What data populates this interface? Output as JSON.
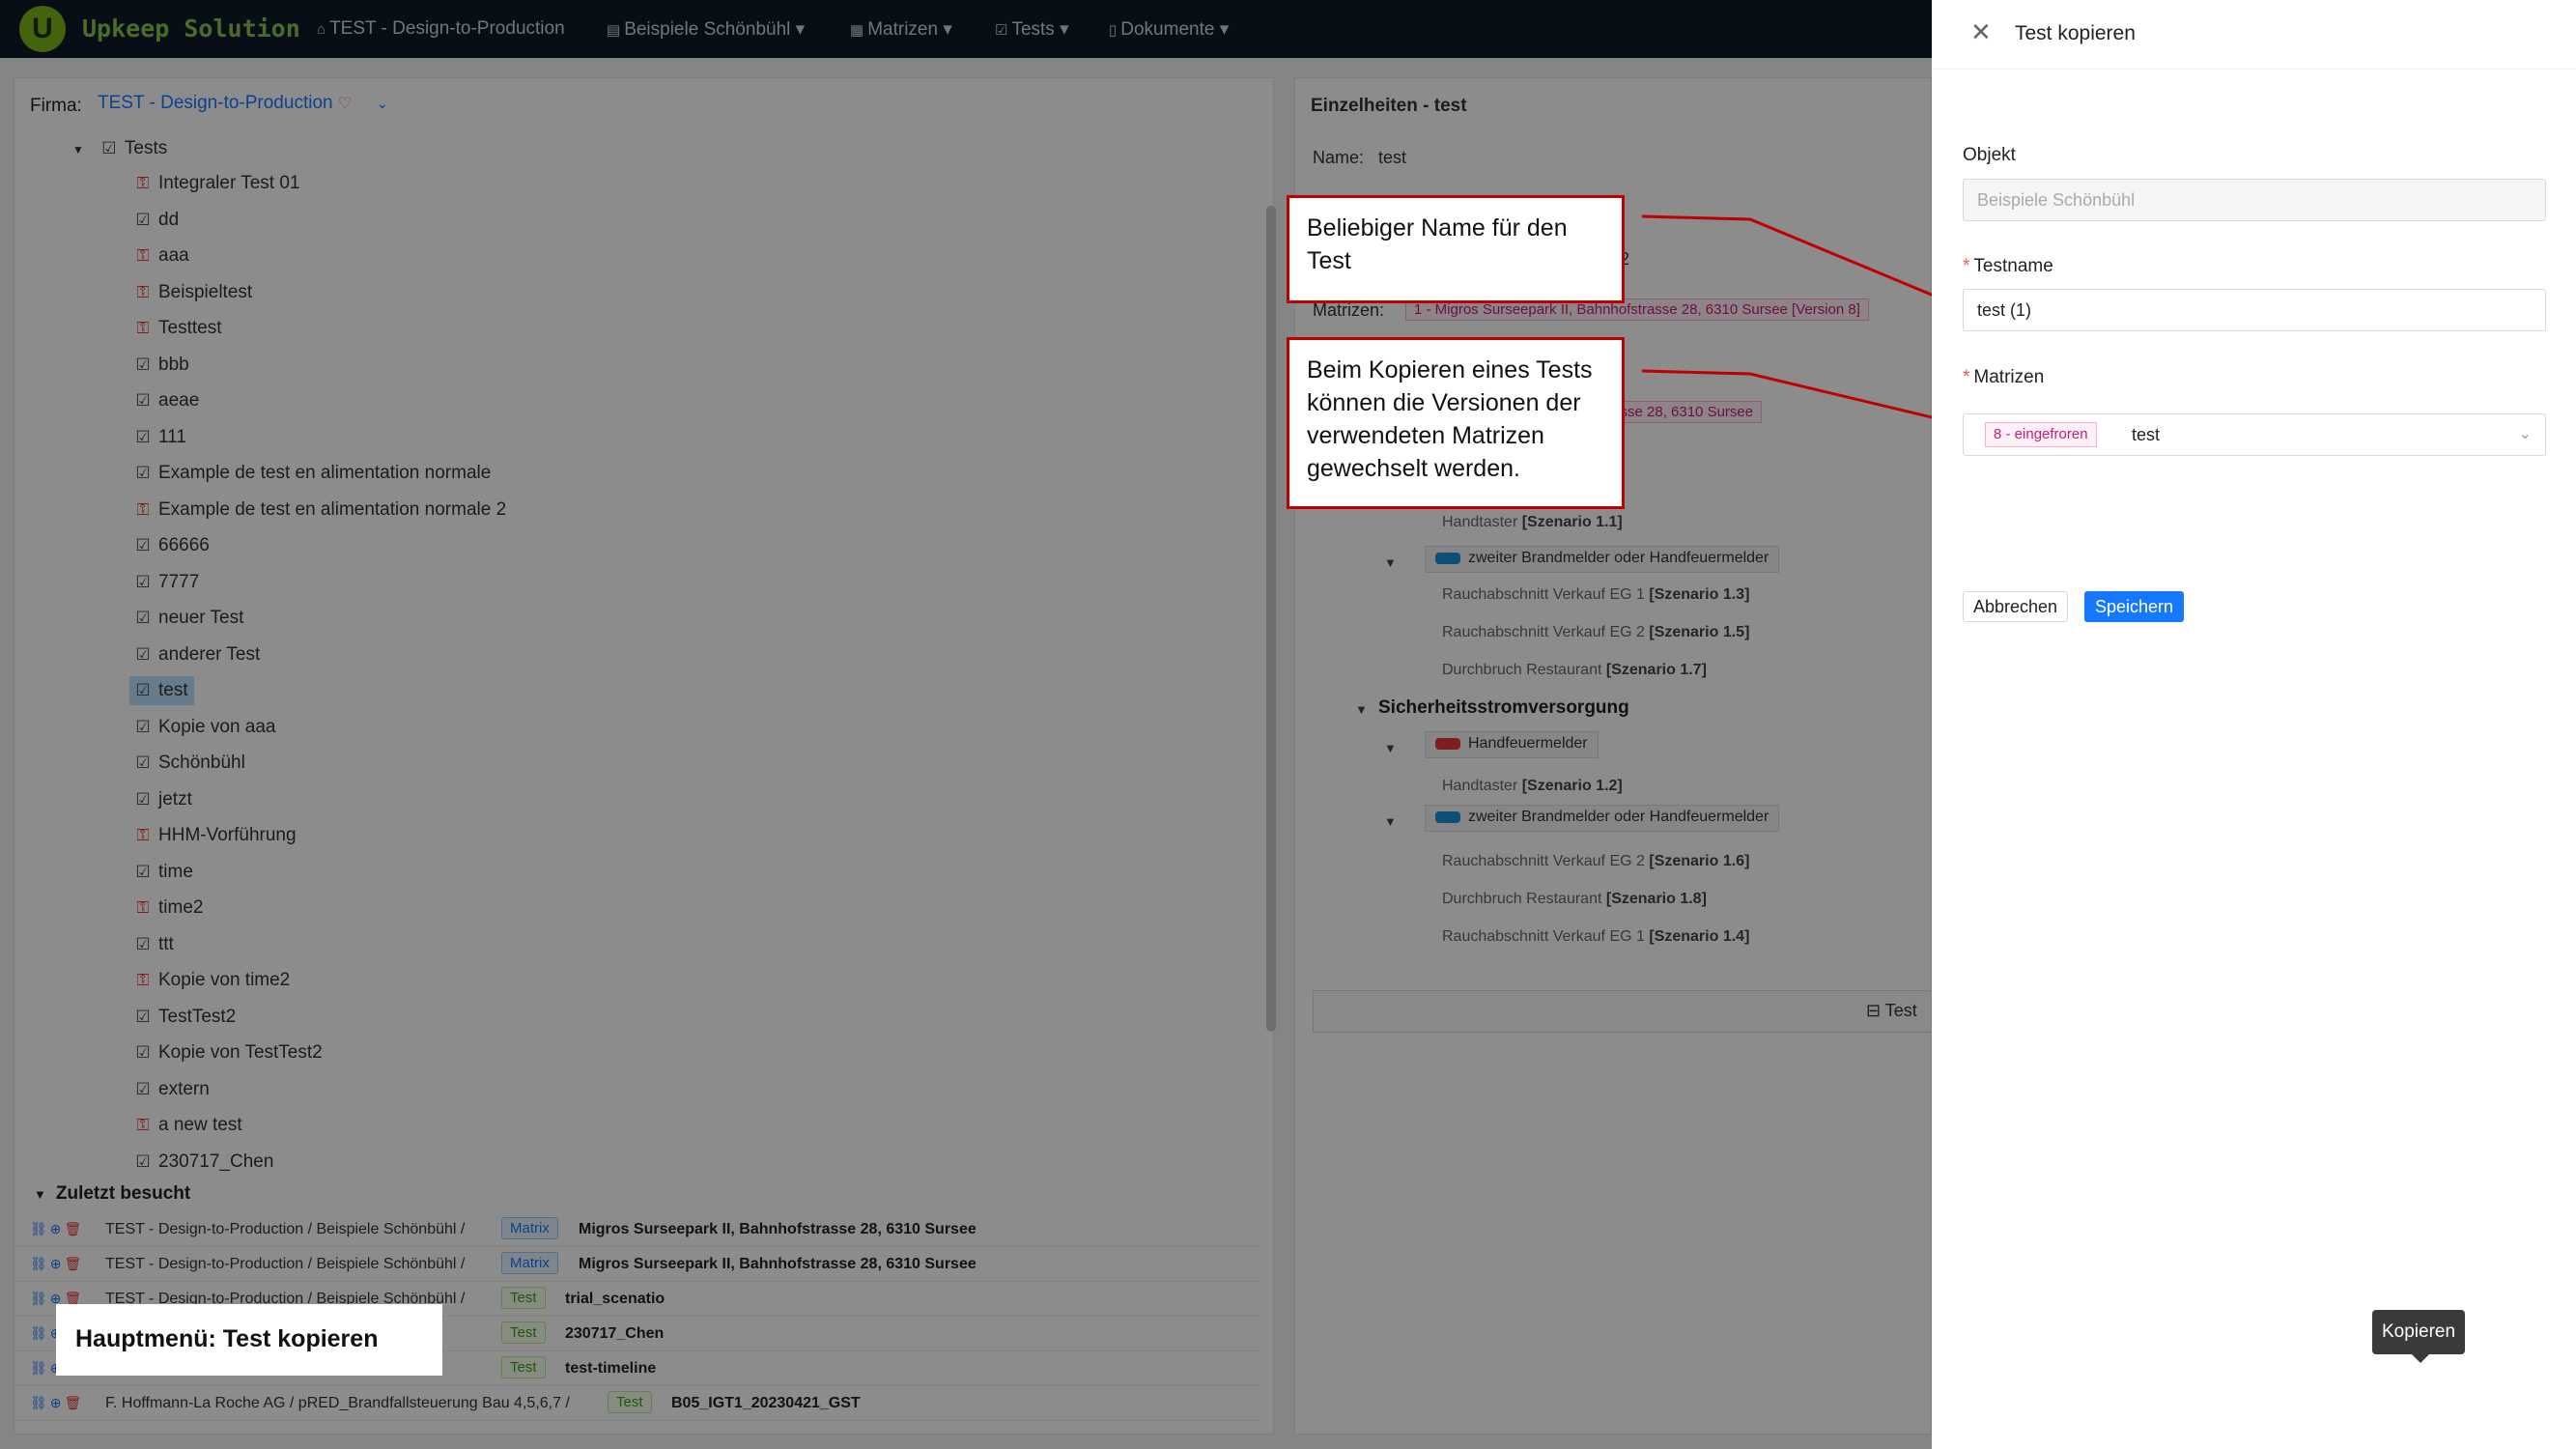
{
  "app": {
    "brand": "Upkeep Solution",
    "logo_letter": "U"
  },
  "nav": [
    {
      "label": "TEST - Design-to-Production",
      "icon": "home-icon",
      "glyph": "⌂"
    },
    {
      "label": "Beispiele Schönbühl",
      "icon": "building-icon",
      "glyph": "▤"
    },
    {
      "label": "Matrizen",
      "icon": "table-icon",
      "glyph": "▦"
    },
    {
      "label": "Tests",
      "icon": "checkbox-icon",
      "glyph": "☑"
    },
    {
      "label": "Dokumente",
      "icon": "document-icon",
      "glyph": "▯"
    }
  ],
  "left": {
    "firma_label": "Firma:",
    "firma_value": "TEST - Design-to-Production",
    "tree_root": "Tests",
    "items": [
      {
        "label": "Integraler Test 01",
        "icon": "lock"
      },
      {
        "label": "dd",
        "icon": "check"
      },
      {
        "label": "aaa",
        "icon": "lock"
      },
      {
        "label": "Beispieltest",
        "icon": "lock"
      },
      {
        "label": "Testtest",
        "icon": "lock"
      },
      {
        "label": "bbb",
        "icon": "check"
      },
      {
        "label": "aeae",
        "icon": "check"
      },
      {
        "label": "111",
        "icon": "check"
      },
      {
        "label": "Example de test en alimentation normale",
        "icon": "check"
      },
      {
        "label": "Example de test en alimentation normale 2",
        "icon": "lock"
      },
      {
        "label": "66666",
        "icon": "check"
      },
      {
        "label": "7777",
        "icon": "check"
      },
      {
        "label": "neuer Test",
        "icon": "check"
      },
      {
        "label": "anderer Test",
        "icon": "check"
      },
      {
        "label": "test",
        "icon": "check",
        "selected": true
      },
      {
        "label": "Kopie von aaa",
        "icon": "check"
      },
      {
        "label": "Schönbühl",
        "icon": "check"
      },
      {
        "label": "jetzt",
        "icon": "check"
      },
      {
        "label": "HHM-Vorführung",
        "icon": "lock"
      },
      {
        "label": "time",
        "icon": "check"
      },
      {
        "label": "time2",
        "icon": "lock"
      },
      {
        "label": "ttt",
        "icon": "check"
      },
      {
        "label": "Kopie von time2",
        "icon": "lock"
      },
      {
        "label": "TestTest2",
        "icon": "check"
      },
      {
        "label": "Kopie von TestTest2",
        "icon": "check"
      },
      {
        "label": "extern",
        "icon": "check"
      },
      {
        "label": "a new test",
        "icon": "lock"
      },
      {
        "label": "230717_Chen",
        "icon": "check"
      }
    ],
    "recent_title": "Zuletzt besucht",
    "recent": [
      {
        "path": "TEST - Design-to-Production / Beispiele Schönbühl /",
        "type": "Matrix",
        "title": "Migros Surseepark II, Bahnhofstrasse 28, 6310 Sursee"
      },
      {
        "path": "TEST - Design-to-Production / Beispiele Schönbühl /",
        "type": "Matrix",
        "title": "Migros Surseepark II, Bahnhofstrasse 28, 6310 Sursee"
      },
      {
        "path": "TEST - Design-to-Production / Beispiele Schönbühl /",
        "type": "Test",
        "title": "trial_scenatio"
      },
      {
        "path": "bühl /",
        "type": "Test",
        "title": "230717_Chen"
      },
      {
        "path": "bühl /",
        "type": "Test",
        "title": "test-timeline"
      },
      {
        "path": "F. Hoffmann-La Roche AG / pRED_Brandfallsteuerung Bau 4,5,6,7 /",
        "type": "Test",
        "title": "B05_IGT1_20230421_GST"
      }
    ]
  },
  "details": {
    "title": "Einzelheiten - test",
    "name_label": "Name:",
    "name_value": "test",
    "partial_2": "2",
    "matrizen_label": "Matrizen:",
    "matrizen_tag": "1 - Migros Surseepark II, Bahnhofstrasse 28, 6310 Sursee [Version 8]",
    "addr_fragment": "trasse 28, 6310 Sursee",
    "section2": "Sicherheitsstromversorgung",
    "pill_blue": "zweiter Brandmelder oder Handfeuermelder",
    "pill_red": "Handfeuermelder",
    "scenarios_a": [
      {
        "name": "Handtaster",
        "code": "[Szenario 1.1]"
      },
      {
        "name": "Rauchabschnitt Verkauf EG 1",
        "code": "[Szenario 1.3]"
      },
      {
        "name": "Rauchabschnitt Verkauf EG 2",
        "code": "[Szenario 1.5]"
      },
      {
        "name": "Durchbruch Restaurant",
        "code": "[Szenario 1.7]"
      }
    ],
    "scenarios_b": [
      {
        "name": "Handtaster",
        "code": "[Szenario 1.2]"
      },
      {
        "name": "Rauchabschnitt Verkauf EG 2",
        "code": "[Szenario 1.6]"
      },
      {
        "name": "Durchbruch Restaurant",
        "code": "[Szenario 1.8]"
      },
      {
        "name": "Rauchabschnitt Verkauf EG 1",
        "code": "[Szenario 1.4]"
      }
    ],
    "bottom_btn": "Test"
  },
  "drawer": {
    "title": "Test kopieren",
    "objekt_label": "Objekt",
    "objekt_value": "Beispiele Schönbühl",
    "testname_label": "Testname",
    "testname_value": "test (1)",
    "matrizen_label": "Matrizen",
    "matrizen_tag": "8 - eingefroren",
    "matrizen_value": "test",
    "cancel": "Abbrechen",
    "save": "Speichern"
  },
  "tooltip": "Kopieren",
  "callouts": {
    "name": "Beliebiger Name für den Test",
    "versions": "Beim Kopieren eines Tests können die Versionen der verwendeten Matrizen gewechselt werden.",
    "hauptmenu": "Hauptmenü: Test kopieren"
  },
  "colors": {
    "accent": "#1677ff",
    "brand": "#7cb518",
    "callout_border": "#c00000",
    "lock": "#e53935"
  }
}
